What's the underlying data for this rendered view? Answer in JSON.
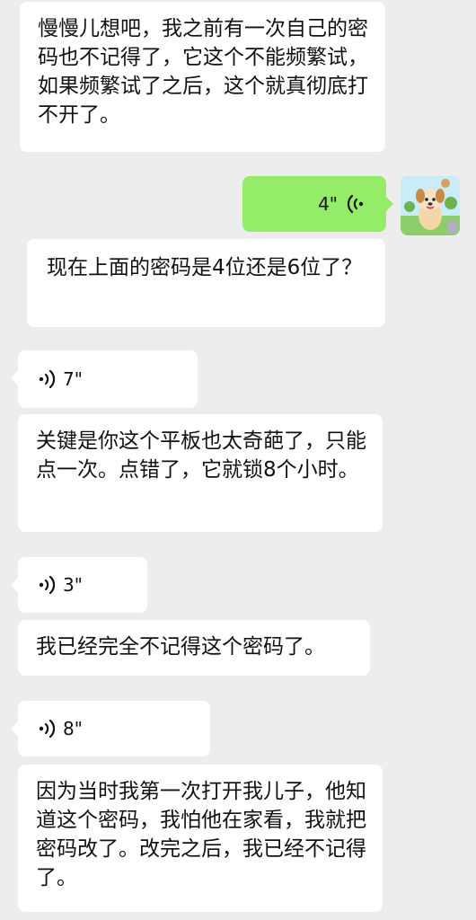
{
  "messages": [
    {
      "type": "text",
      "side": "incoming",
      "text": "慢慢儿想吧，我之前有一次自己的密码也不记得了，它这个不能频繁试，如果频繁试了之后，这个就真彻底打不开了。"
    },
    {
      "type": "voice",
      "side": "outgoing",
      "duration": "4\""
    },
    {
      "type": "text",
      "side": "incoming",
      "text": "现在上面的密码是4位还是6位了？"
    },
    {
      "type": "voice",
      "side": "incoming",
      "duration": "7\""
    },
    {
      "type": "text",
      "side": "incoming",
      "text": "关键是你这个平板也太奇葩了，只能点一次。点错了，它就锁8个小时。"
    },
    {
      "type": "voice",
      "side": "incoming",
      "duration": "3\""
    },
    {
      "type": "text",
      "side": "incoming",
      "text": "我已经完全不记得这个密码了。"
    },
    {
      "type": "voice",
      "side": "incoming",
      "duration": "8\""
    },
    {
      "type": "text",
      "side": "incoming",
      "text": "因为当时我第一次打开我儿子，他知道这个密码，我怕他在家看，我就把密码改了。改完之后，我已经不记得了。"
    }
  ],
  "colors": {
    "background": "#ededed",
    "incoming_bubble": "#ffffff",
    "outgoing_bubble": "#95ec69"
  },
  "avatar": {
    "icon": "cartoon-dog-avatar"
  }
}
